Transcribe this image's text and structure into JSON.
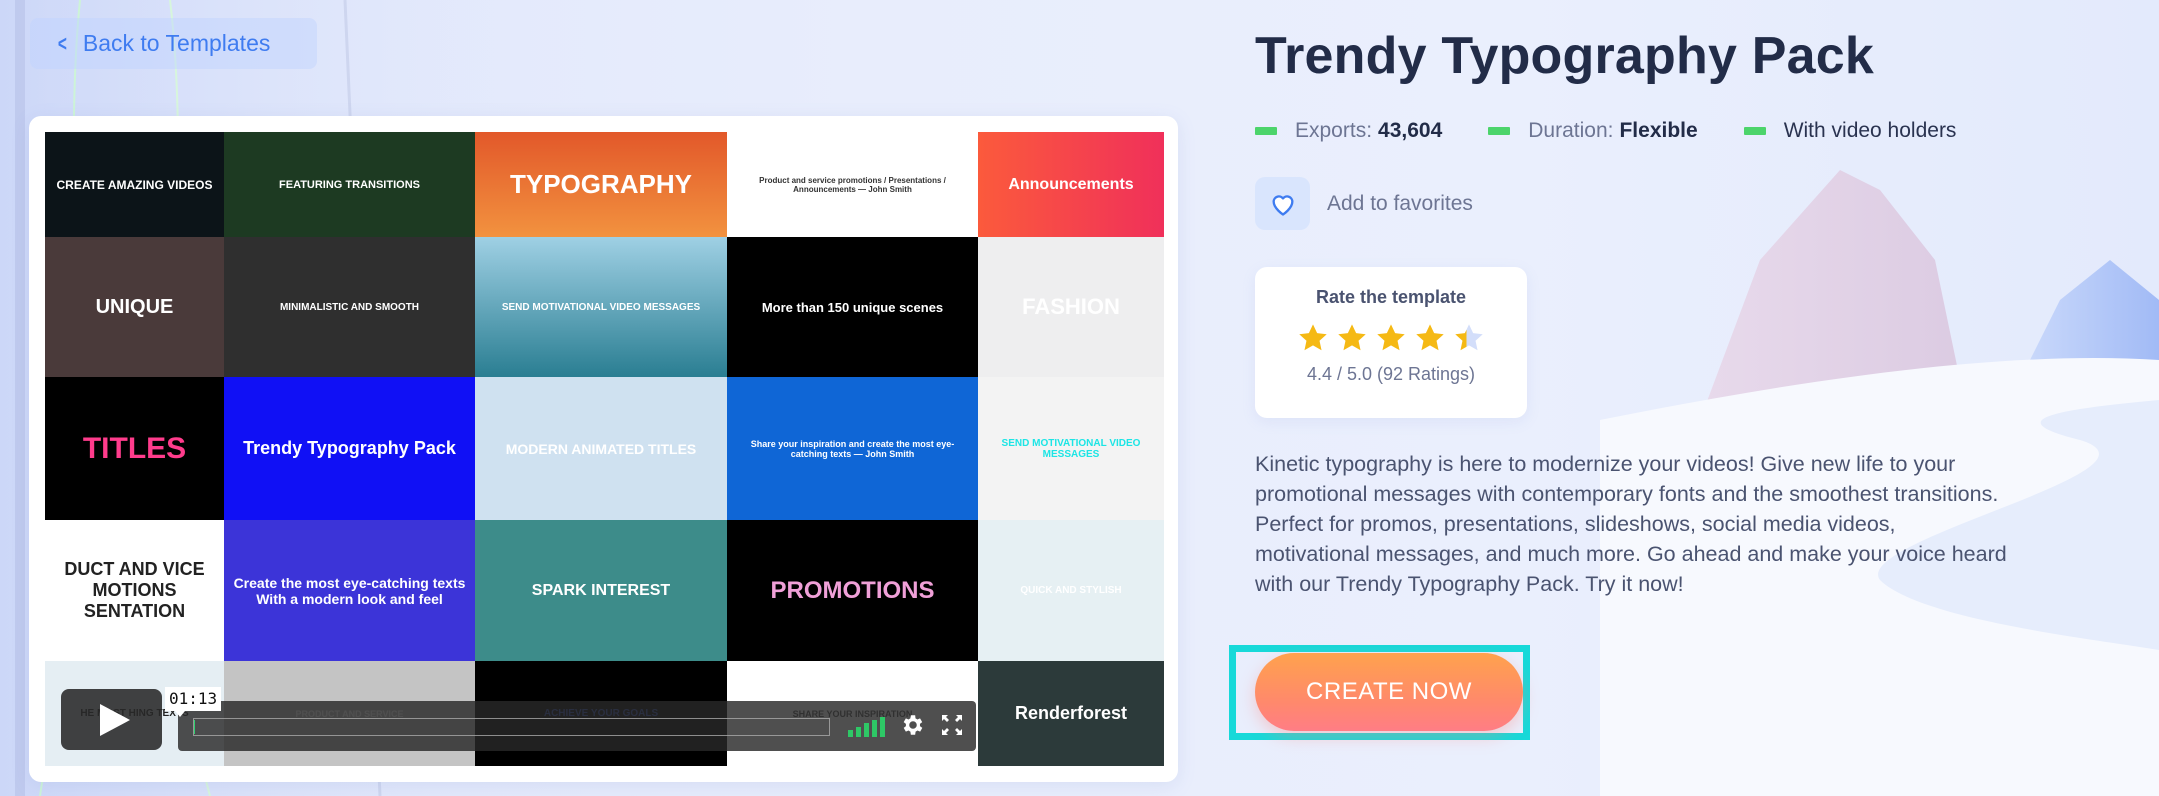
{
  "nav": {
    "back_label": "Back to Templates"
  },
  "template": {
    "title": "Trendy Typography Pack",
    "stats": [
      {
        "label": "Exports:",
        "value": "43,604"
      },
      {
        "label": "Duration:",
        "value": "Flexible"
      },
      {
        "label": "With video holders",
        "value": ""
      }
    ],
    "favorites_label": "Add to favorites",
    "rating": {
      "heading": "Rate the template",
      "score": 4.4,
      "max": 5,
      "summary": "4.4 / 5.0 (92 Ratings)"
    },
    "description": "Kinetic typography is here to modernize your videos! Give new life to your promotional messages with contemporary fonts and the smoothest transitions. Perfect for promos, presentations, slideshows, social media videos, motivational messages, and much more. Go ahead and make your voice heard with our Trendy Typography Pack. Try it now!",
    "cta_label": "CREATE NOW"
  },
  "player": {
    "timecode": "01:13",
    "progress": 0.0,
    "tiles": [
      "CREATE AMAZING VIDEOS",
      "FEATURING TRANSITIONS",
      "TYPOGRAPHY",
      "Product and service promotions / Presentations / Announcements — John Smith",
      "Announcements",
      "UNIQUE",
      "MINIMALISTIC AND SMOOTH",
      "SEND MOTIVATIONAL VIDEO MESSAGES",
      "More than 150 unique scenes",
      "FASHION",
      "TITLES",
      "Trendy Typography Pack",
      "MODERN ANIMATED TITLES",
      "Share your inspiration and create the most eye-catching texts — John Smith",
      "SEND MOTIVATIONAL VIDEO MESSAGES",
      "DUCT AND VICE MOTIONS SENTATION",
      "Create the most eye-catching texts With a modern look and feel",
      "SPARK INTEREST",
      "PROMOTIONS",
      "QUICK AND STYLISH",
      "HE MOST HING TEXTS",
      "PRODUCT AND SERVICE",
      "ACHIEVE YOUR GOALS",
      "SHARE YOUR INSPIRATION",
      "Renderforest"
    ]
  },
  "colors": {
    "accent": "#3f7cf0",
    "title": "#222c48",
    "bullet": "#4cd46b",
    "cta_top": "#ffa24d",
    "cta_bottom": "#ff7d85",
    "highlight": "#17d9d9",
    "star": "#f5b914"
  }
}
